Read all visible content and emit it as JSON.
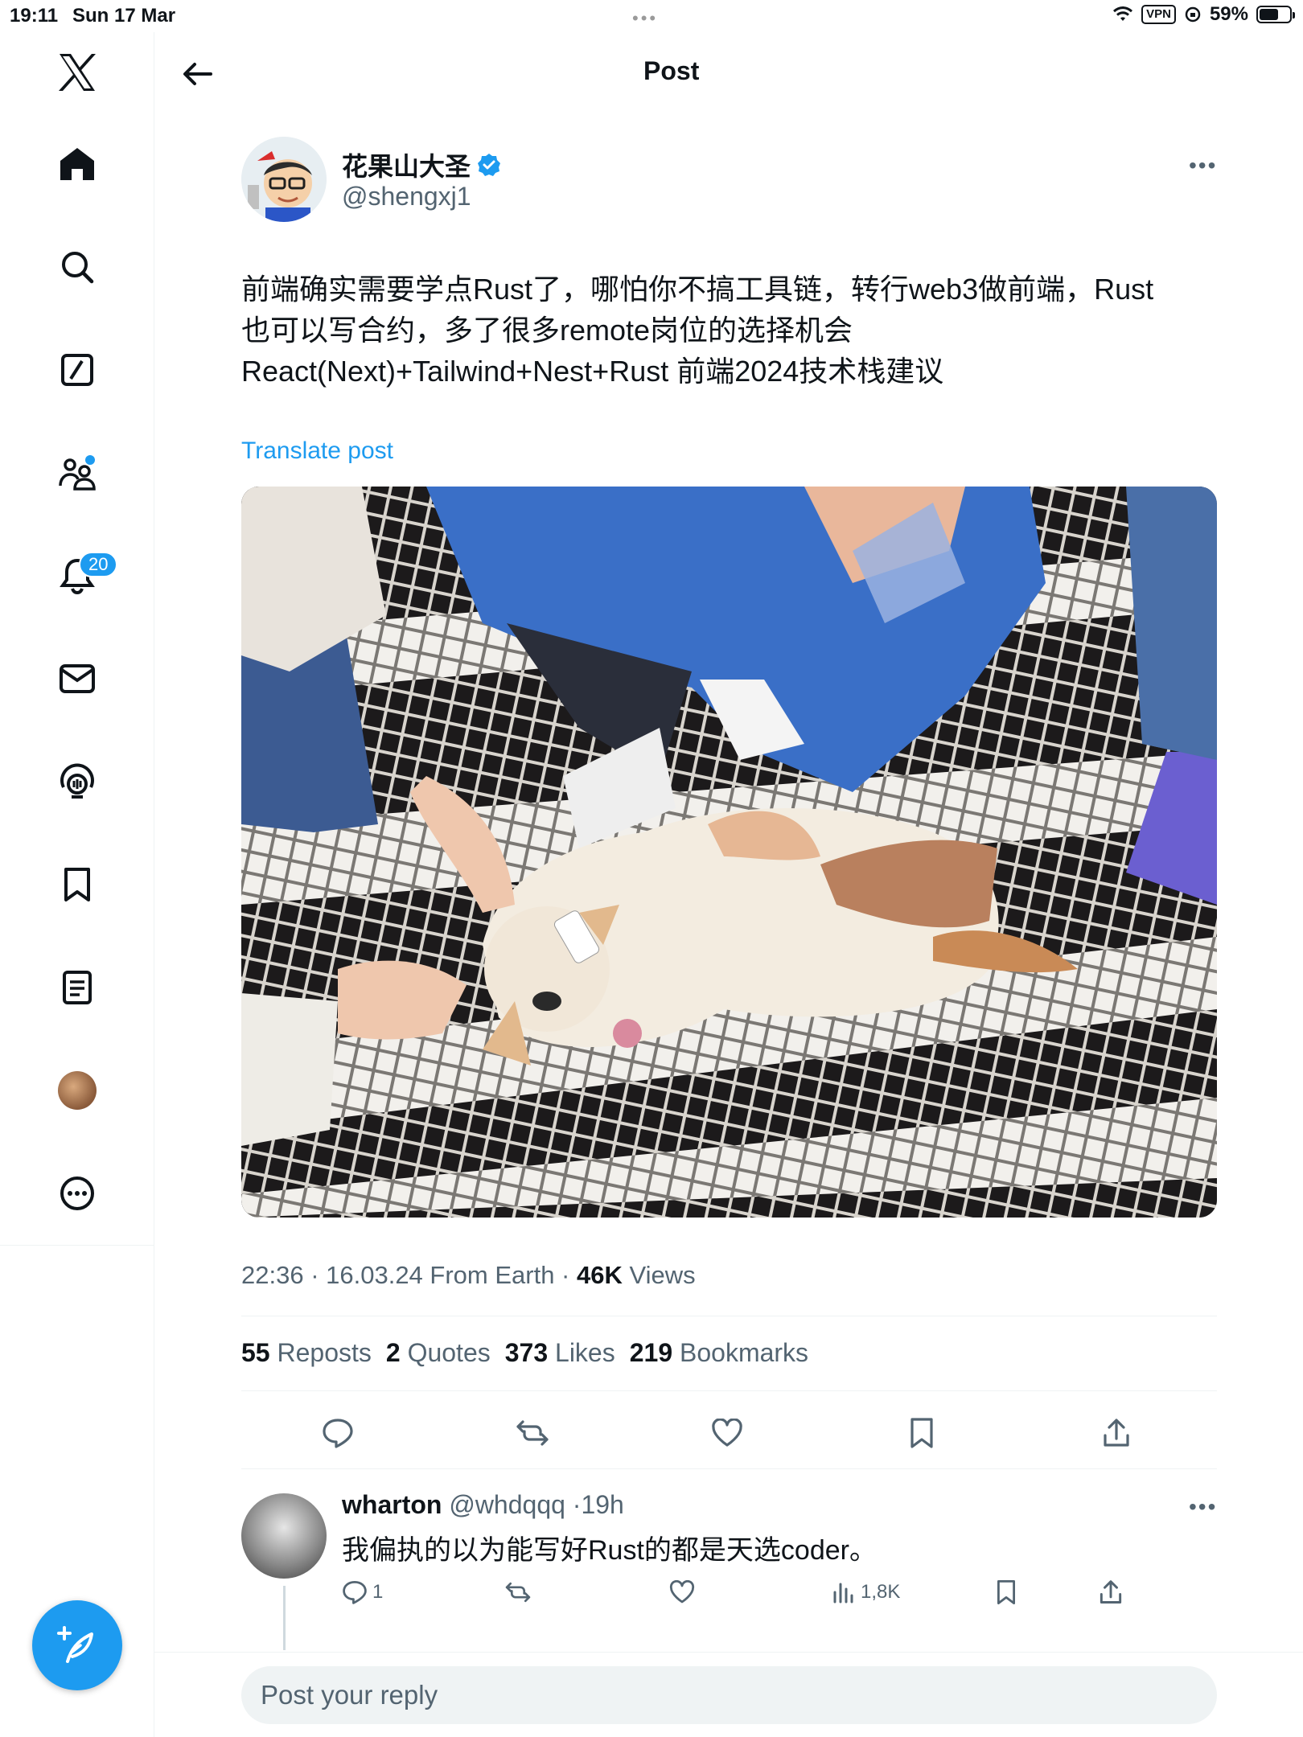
{
  "statusbar": {
    "time": "19:11",
    "date": "Sun 17 Mar",
    "vpn": "VPN",
    "battery": "59%"
  },
  "sidebar": {
    "notifications_badge": "20",
    "items": [
      "home",
      "explore",
      "grok",
      "communities",
      "notifications",
      "messages",
      "spaces",
      "bookmarks",
      "lists",
      "profile",
      "more"
    ]
  },
  "header": {
    "title": "Post"
  },
  "post": {
    "author_name": "花果山大圣",
    "author_handle": "@shengxj1",
    "text_line1": "前端确实需要学点Rust了，哪怕你不搞工具链，转行web3做前端，Rust",
    "text_line2": "也可以写合约，多了很多remote岗位的选择机会",
    "text_line3": "React(Next)+Tailwind+Nest+Rust 前端2024技术栈建议",
    "translate": "Translate post",
    "meta_time": "22:36 · 16.03.24 From Earth · ",
    "views_count": "46K",
    "views_label": " Views",
    "reposts_count": "55",
    "reposts_label": "Reposts",
    "quotes_count": "2",
    "quotes_label": "Quotes",
    "likes_count": "373",
    "likes_label": "Likes",
    "bookmarks_count": "219",
    "bookmarks_label": "Bookmarks"
  },
  "reply": {
    "name": "wharton",
    "handle": "@whdqqq",
    "time": "19h",
    "text": "我偏执的以为能写好Rust的都是天选coder。",
    "replies_count": "1",
    "views": "1,8K"
  },
  "composer": {
    "placeholder": "Post your reply"
  },
  "colors": {
    "accent": "#1d9bf0",
    "text": "#0f1419",
    "muted": "#536471",
    "border": "#eff3f4"
  }
}
